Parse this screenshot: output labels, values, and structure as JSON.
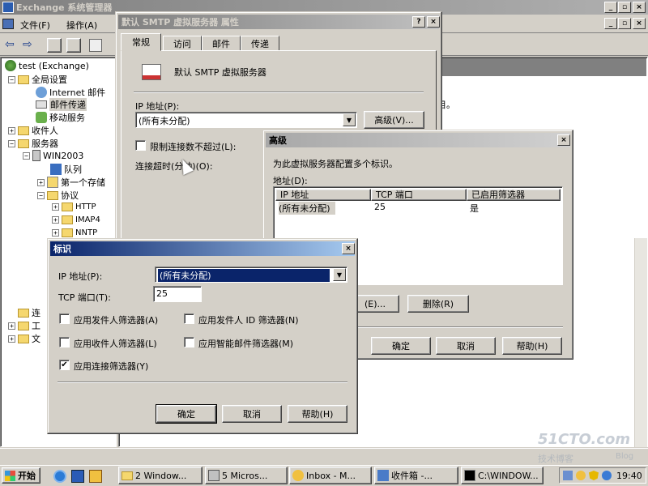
{
  "main_window": {
    "title": "Exchange 系统管理器",
    "menu": [
      "文件(F)",
      "操作(A)"
    ],
    "right_text": "目。"
  },
  "tree": {
    "root": "test (Exchange)",
    "global": "全局设置",
    "internet": "Internet 邮件",
    "mail_transfer": "邮件传递",
    "mobile": "移动服务",
    "recipients": "收件人",
    "servers": "服务器",
    "win2003": "WIN2003",
    "queue": "队列",
    "storage": "第一个存储",
    "protocols": "协议",
    "http": "HTTP",
    "imap": "IMAP4",
    "nntp": "NNTP",
    "c1": "连",
    "c2": "工",
    "c3": "文"
  },
  "props": {
    "title": "默认 SMTP 虚拟服务器 属性",
    "tabs": [
      "常规",
      "访问",
      "邮件",
      "传递"
    ],
    "server_name": "默认 SMTP 虚拟服务器",
    "ip_label": "IP 地址(P):",
    "ip_value": "(所有未分配)",
    "advanced_btn": "高级(V)...",
    "limit_label": "限制连接数不超过(L):",
    "timeout_label": "连接超时(分钟)(O):"
  },
  "advanced": {
    "title": "高级",
    "desc": "为此虚拟服务器配置多个标识。",
    "addr_label": "地址(D):",
    "columns": [
      "IP 地址",
      "TCP 端口",
      "已启用筛选器"
    ],
    "rows": [
      [
        "(所有未分配)",
        "25",
        "是"
      ]
    ],
    "edit_btn": "(E)...",
    "delete_btn": "删除(R)",
    "ok": "确定",
    "cancel": "取消",
    "help": "帮助(H)"
  },
  "ident": {
    "title": "标识",
    "ip_label": "IP 地址(P):",
    "ip_value": "(所有未分配)",
    "tcp_label": "TCP 端口(T):",
    "tcp_value": "25",
    "cb1": "应用发件人筛选器(A)",
    "cb2": "应用发件人 ID 筛选器(N)",
    "cb3": "应用收件人筛选器(L)",
    "cb4": "应用智能邮件筛选器(M)",
    "cb5": "应用连接筛选器(Y)",
    "ok": "确定",
    "cancel": "取消",
    "help": "帮助(H)"
  },
  "taskbar": {
    "start": "开始",
    "items": [
      "2 Window...",
      "5 Micros...",
      "Inbox - M...",
      "收件箱 -...",
      "C:\\WINDOW..."
    ],
    "clock": "19:40"
  },
  "watermark": {
    "line1": "51CTO.com",
    "line2": "技术博客",
    "line3": "Blog"
  }
}
